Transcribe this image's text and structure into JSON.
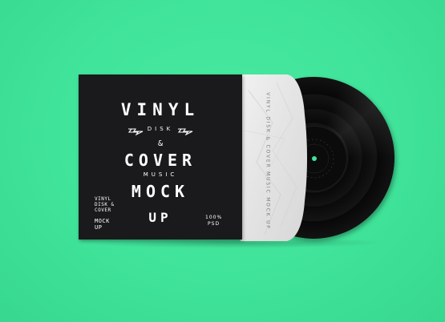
{
  "scene": {
    "background_color": "#40e39a",
    "accent_color": "#41e39c"
  },
  "cover": {
    "line1": "VINYL",
    "line2": "DISK",
    "line3": "&",
    "line4": "COVER",
    "line5": "MUSIC",
    "line6": "MOCK",
    "line7": "UP",
    "corner_small_line1": "VINYL",
    "corner_small_line2": "DISK &",
    "corner_small_line3": "COVER",
    "corner_small_line4": "MOCK",
    "corner_small_line5": "UP",
    "badge_line1": "100%",
    "badge_line2": "PSD",
    "color": "#1a1a1c"
  },
  "sleeve": {
    "text": "VINYL DISK & COVER MUSIC MOCK UP"
  },
  "record": {
    "label_color": "#0b0b0b",
    "spindle_color": "#41e39c"
  }
}
